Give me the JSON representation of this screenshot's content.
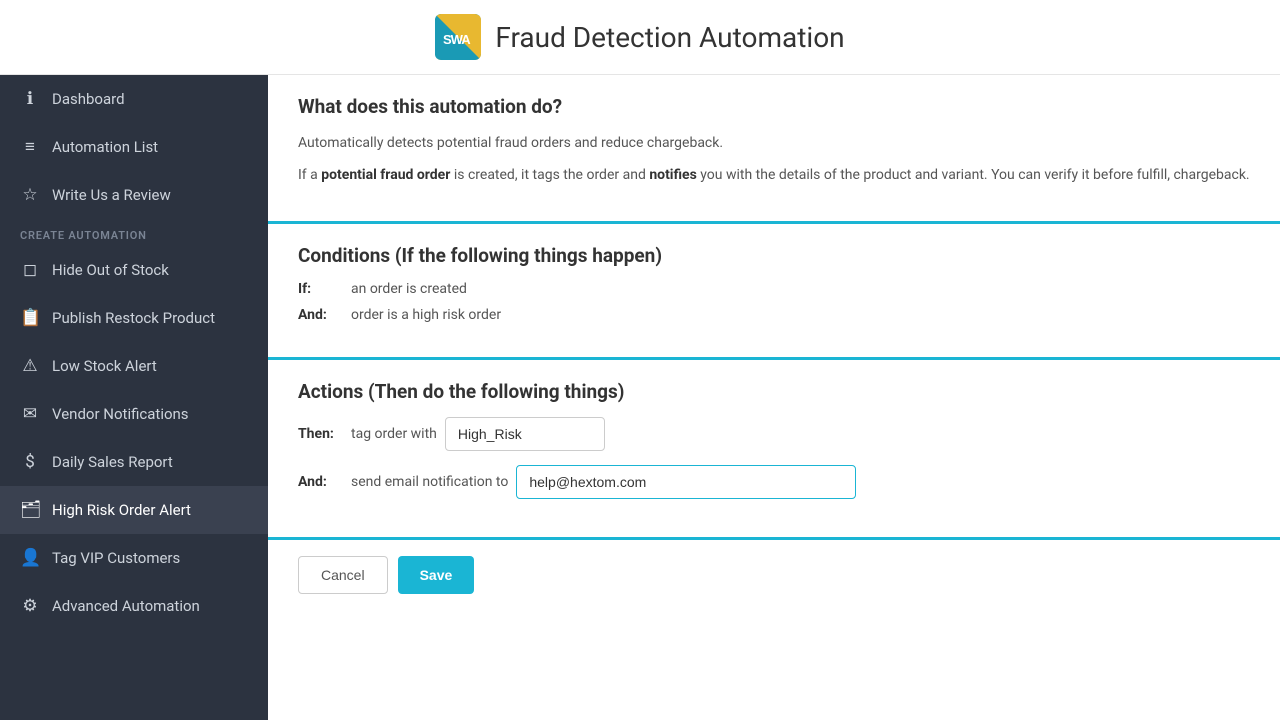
{
  "header": {
    "logo_text": "SWA",
    "title": "Fraud Detection Automation"
  },
  "sidebar": {
    "items": [
      {
        "id": "dashboard",
        "label": "Dashboard",
        "icon": "ℹ",
        "active": false
      },
      {
        "id": "automation-list",
        "label": "Automation List",
        "icon": "☰",
        "active": false
      },
      {
        "id": "write-review",
        "label": "Write Us a Review",
        "icon": "☆",
        "active": false
      }
    ],
    "create_automation_label": "CREATE AUTOMATION",
    "create_items": [
      {
        "id": "hide-out-of-stock",
        "label": "Hide Out of Stock",
        "icon": "📦",
        "active": false
      },
      {
        "id": "publish-restock",
        "label": "Publish Restock Product",
        "icon": "📋",
        "active": false
      },
      {
        "id": "low-stock-alert",
        "label": "Low Stock Alert",
        "icon": "⚠",
        "active": false
      },
      {
        "id": "vendor-notifications",
        "label": "Vendor Notifications",
        "icon": "✉",
        "active": false
      },
      {
        "id": "daily-sales-report",
        "label": "Daily Sales Report",
        "icon": "$",
        "active": false
      },
      {
        "id": "high-risk-order",
        "label": "High Risk Order Alert",
        "icon": "🗂",
        "active": true
      },
      {
        "id": "tag-vip",
        "label": "Tag VIP Customers",
        "icon": "👤",
        "active": false
      },
      {
        "id": "advanced-automation",
        "label": "Advanced Automation",
        "icon": "⚙",
        "active": false
      }
    ]
  },
  "main": {
    "what_section": {
      "title": "What does this automation do?",
      "desc1": "Automatically detects potential fraud orders and reduce chargeback.",
      "desc2_parts": {
        "prefix": "If a ",
        "bold1": "potential fraud order",
        "middle": " is created, it tags the order and ",
        "bold2": "notifies",
        "suffix": " you with the details of the product and variant. You can verify it before fulfill, chargeback."
      }
    },
    "conditions_section": {
      "title": "Conditions (If the following things happen)",
      "rows": [
        {
          "label": "If:",
          "text": "an order is created"
        },
        {
          "label": "And:",
          "text": "order is a high risk order"
        }
      ]
    },
    "actions_section": {
      "title": "Actions (Then do the following things)",
      "then_label": "Then:",
      "then_text": "tag order with",
      "tag_value": "High_Risk",
      "and_label": "And:",
      "and_text": "send email notification to",
      "email_value": "help@hextom.com"
    },
    "buttons": {
      "cancel": "Cancel",
      "save": "Save"
    }
  }
}
